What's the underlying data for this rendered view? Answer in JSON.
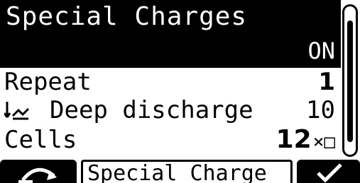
{
  "menu": {
    "title": "Special Charges",
    "state": "ON",
    "items": [
      {
        "label": "Repeat",
        "value": "1"
      },
      {
        "label": "Deep discharge",
        "value": "10",
        "icon": "deep-discharge-icon"
      },
      {
        "label": "Cells",
        "value": "12",
        "unit": "×□"
      }
    ]
  },
  "softkeys": {
    "left_icon": "back-icon",
    "center_label": "Special Charge",
    "right_icon": "checkmark-icon"
  }
}
